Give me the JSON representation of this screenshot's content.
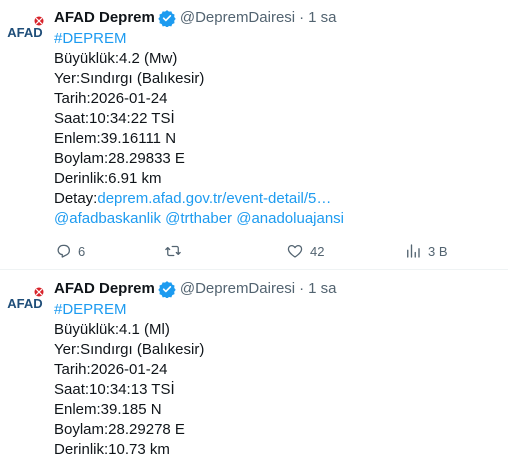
{
  "brand": {
    "logo_text": "AFAD",
    "logo_color": "#1f4e79",
    "accent_color": "#1d9bf0",
    "secondary_text_color": "#536471"
  },
  "tweets": [
    {
      "author": {
        "display_name": "AFAD Deprem",
        "handle": "@DepremDairesi",
        "verified_icon": "verified-badge-icon"
      },
      "separator": "·",
      "time": "1 sa",
      "hashtag": "#DEPREM",
      "lines": [
        "Büyüklük:4.2 (Mw)",
        "Yer:Sındırgı (Balıkesir)",
        "Tarih:2026-01-24",
        "Saat:10:34:22 TSİ",
        "Enlem:39.16111 N",
        "Boylam:28.29833 E",
        "Derinlik:6.91 km"
      ],
      "detail_label": "Detay:",
      "detail_link": "deprem.afad.gov.tr/event-detail/5…",
      "mentions": "@afadbaskanlik @trthaber @anadoluajansi",
      "actions": {
        "reply_count": "6",
        "retweet_count": "",
        "like_count": "42",
        "views_count": "3 B"
      }
    },
    {
      "author": {
        "display_name": "AFAD Deprem",
        "handle": "@DepremDairesi",
        "verified_icon": "verified-badge-icon"
      },
      "separator": "·",
      "time": "1 sa",
      "hashtag": "#DEPREM",
      "lines": [
        "Büyüklük:4.1 (Ml)",
        "Yer:Sındırgı (Balıkesir)",
        "Tarih:2026-01-24",
        "Saat:10:34:13 TSİ",
        "Enlem:39.185 N",
        "Boylam:28.29278 E",
        "Derinlik:10.73 km"
      ]
    }
  ]
}
